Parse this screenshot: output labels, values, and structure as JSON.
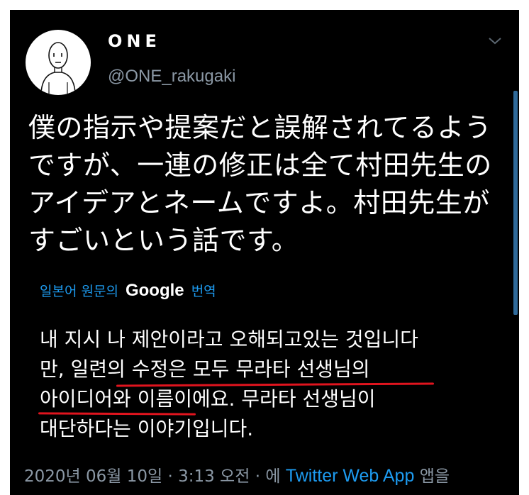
{
  "user": {
    "display_name": "ONE",
    "handle": "@ONE_rakugaki"
  },
  "tweet": {
    "lines": [
      "僕の指示や提案だと誤解されてるよう",
      "ですが、一連の修正は全て村田先生の",
      "アイデアとネームですよ。村田先生が",
      "すごいという話です。"
    ]
  },
  "translation": {
    "prefix": "일본어 원문의",
    "google": "Google",
    "suffix": "번역",
    "lines": [
      "내 지시 나 제안이라고 오해되고있는 것입니다",
      "만, 일련의 수정은 모두 무라타 선생님의",
      "아이디어와 이름이에요. 무라타 선생님이",
      "대단하다는 이야기입니다."
    ]
  },
  "meta": {
    "timestamp": "2020년 06월 10일 · 3:13 오전 · 에",
    "app": "Twitter Web App",
    "suffix": "앱을"
  },
  "icons": {
    "avatar": "hand-drawn-bald-person-avatar",
    "menu": "chevron-down-icon"
  },
  "colors": {
    "background": "#000000",
    "text": "#ffffff",
    "secondary": "#8b98a5",
    "link": "#1d9bf0",
    "annotation": "#e0141e"
  }
}
